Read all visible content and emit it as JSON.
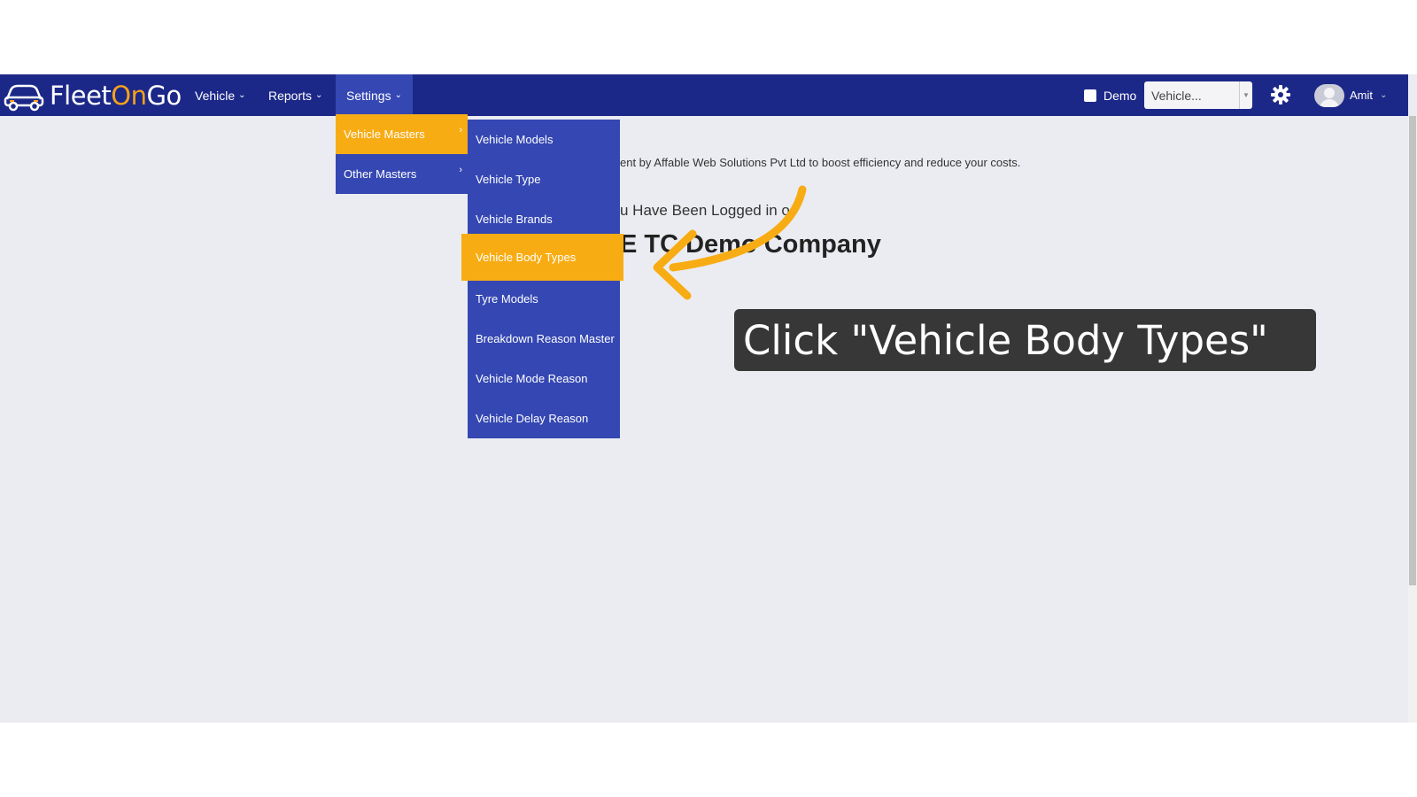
{
  "app": {
    "logo_part1": "Fleet",
    "logo_part2": "On",
    "logo_part3": "Go"
  },
  "nav": {
    "vehicle": "Vehicle",
    "reports": "Reports",
    "settings": "Settings"
  },
  "header": {
    "demo_label": "Demo",
    "vehicle_select": "Vehicle...",
    "user_name": "Amit"
  },
  "settings_menu": [
    {
      "label": "Vehicle Masters"
    },
    {
      "label": "Other Masters"
    }
  ],
  "vehicle_masters_menu": [
    {
      "label": "Vehicle Models"
    },
    {
      "label": "Vehicle Type"
    },
    {
      "label": "Vehicle Brands"
    },
    {
      "label": "Vehicle Body Types"
    },
    {
      "label": "Tyre Models"
    },
    {
      "label": "Breakdown Reason Master"
    },
    {
      "label": "Vehicle Mode Reason"
    },
    {
      "label": "Vehicle Delay Reason"
    }
  ],
  "content": {
    "intro": "ent by Affable Web Solutions Pvt Ltd to boost efficiency and reduce your costs.",
    "logged": "u Have Been Logged in o",
    "welcome": "E TC Demo Company"
  },
  "callout": {
    "text": "Click \"Vehicle Body Types\""
  },
  "colors": {
    "navbar": "#1c2888",
    "menu": "#3547b3",
    "highlight": "#f8ac14",
    "brand_orange": "#f7a21b"
  }
}
